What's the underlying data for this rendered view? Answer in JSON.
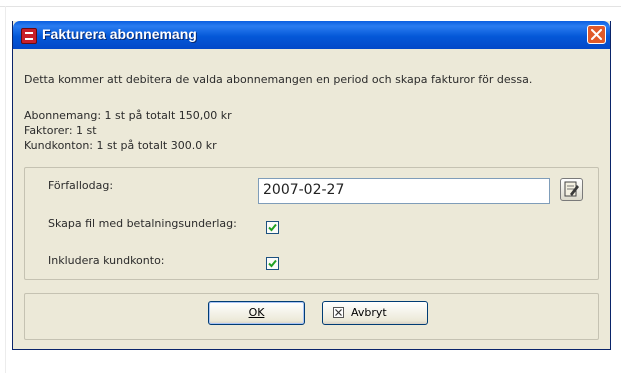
{
  "window": {
    "title": "Fakturera abonnemang",
    "icons": {
      "app": "app-icon",
      "close": "close-icon"
    }
  },
  "info": {
    "description": "Detta kommer att debitera de valda abonnemangen en period och skapa fakturor för dessa.",
    "subscriptions": "Abonnemang: 1 st på totalt 150,00 kr",
    "invoices": "Faktorer: 1 st",
    "customer_accounts": "Kundkonton: 1 st på totalt 300.0 kr"
  },
  "form": {
    "due_date_label": "Förfallodag:",
    "due_date_value": "2007-02-27",
    "payment_file_label": "Skapa fil med betalningsunderlag:",
    "payment_file_checked": true,
    "include_account_label": "Inkludera kundkonto:",
    "include_account_checked": true,
    "calendar_icon": "calendar-edit-icon"
  },
  "buttons": {
    "ok": "OK",
    "cancel": "Avbryt",
    "cancel_icon": "cancel-x-icon"
  },
  "colors": {
    "titlebar": "#0458d8",
    "dialog_bg": "#ece9d8",
    "close_button": "#e05a2a",
    "check_mark": "#21a121"
  }
}
